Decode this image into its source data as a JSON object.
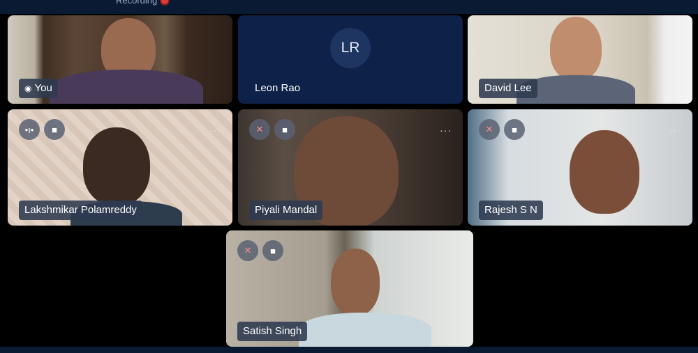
{
  "header": {
    "recording_label": "Recording"
  },
  "participants": [
    {
      "name": "You",
      "speaking": true
    },
    {
      "name": "Leon Rao",
      "initials": "LR",
      "video": false
    },
    {
      "name": "David Lee"
    },
    {
      "name": "Lakshmikar Polamreddy"
    },
    {
      "name": "Piyali Mandal",
      "mic_muted": true
    },
    {
      "name": "Rajesh S N",
      "mic_muted": true
    },
    {
      "name": "Satish Singh",
      "mic_muted": true
    }
  ],
  "icons": {
    "speaking": "speaking-icon",
    "mic_muted": "mic-off-icon",
    "camera": "camera-icon",
    "more": "more-options-icon",
    "recording": "recording-dot-icon"
  },
  "colors": {
    "top_bar": "#0b1a33",
    "avatar_tile": "#0d2149",
    "recording_dot": "#e03b3b",
    "name_chip": "#2d3a50"
  }
}
